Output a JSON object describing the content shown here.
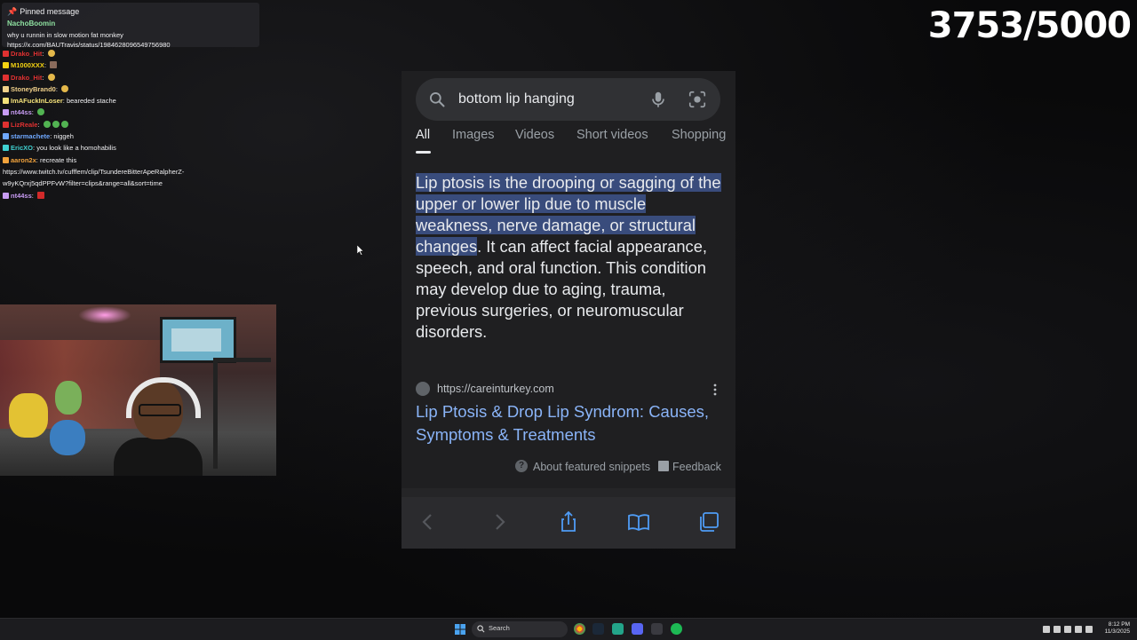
{
  "counter": "3753/5000",
  "chat": {
    "pinned": {
      "header": "Pinned message",
      "user": "NachoBoomin",
      "line1": "why u runnin in slow motion fat monkey",
      "line2": "https://x.com/BAUTravis/status/1984628096549756980"
    },
    "messages": [
      {
        "user": "Drako_Hit",
        "text": "",
        "color": "#e03131",
        "emote": "yellow"
      },
      {
        "user": "M1000XXX",
        "text": "",
        "color": "#f5d312",
        "emote": "sq"
      },
      {
        "user": "Drako_Hit",
        "text": "",
        "color": "#e03131",
        "emote": "yellow"
      },
      {
        "user": "StoneyBrand0",
        "text": "",
        "color": "#f0d08a",
        "emote": "yellow"
      },
      {
        "user": "ImAFuckInLoser",
        "text": "beareded stache",
        "color": "#f5e27a",
        "emote": ""
      },
      {
        "user": "nt44ss",
        "text": "",
        "color": "#c79bf2",
        "emote": "green"
      },
      {
        "user": "LizReale",
        "text": "",
        "color": "#e03131",
        "emote": "green3"
      },
      {
        "user": "starmachete",
        "text": "niggeh",
        "color": "#6fa8ff",
        "emote": ""
      },
      {
        "user": "EricXO",
        "text": "you look like a homohabilis",
        "color": "#3fd1d1",
        "emote": ""
      },
      {
        "user": "aaron2x",
        "text": "recreate this",
        "color": "#f2a33c",
        "emote": ""
      },
      {
        "user": "",
        "text": "https://www.twitch.tv/cufffem/clip/TsundereBitterApeRalpherZ-",
        "color": "#efeff1",
        "emote": ""
      },
      {
        "user": "",
        "text": "w9yKQrxj5qdPPFvW?filter=clips&range=all&sort=time",
        "color": "#efeff1",
        "emote": ""
      },
      {
        "user": "nt44ss",
        "text": "",
        "color": "#c79bf2",
        "emote": "red"
      }
    ]
  },
  "phone": {
    "search_query": "bottom lip hanging",
    "tabs": [
      "All",
      "Images",
      "Videos",
      "Short videos",
      "Shopping"
    ],
    "snippet_highlight": "Lip ptosis is the drooping or sagging of the upper or lower lip due to muscle weakness, nerve damage, or structural changes",
    "snippet_rest": ". It can affect facial appearance, speech, and oral function. This condition may develop due to aging, trauma, previous surgeries, or neuromuscular disorders.",
    "source_url": "https://careinturkey.com",
    "result_title": "Lip Ptosis & Drop Lip Syndrom: Causes, Symptoms & Treatments",
    "about_label": "About featured snippets",
    "feedback_label": "Feedback"
  },
  "taskbar": {
    "search_label": "Search",
    "time": "8:12 PM",
    "date": "11/3/2025"
  },
  "colors": {
    "accent_link": "#8ab4f8",
    "highlight": "#394c7c",
    "page_bg": "#1f1f21"
  }
}
